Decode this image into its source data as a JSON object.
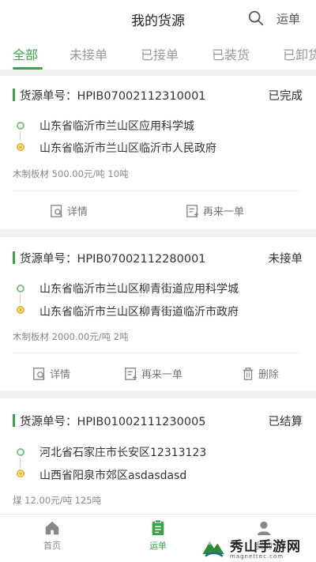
{
  "header": {
    "title": "我的货源",
    "waybill_label": "运单"
  },
  "tabs": [
    {
      "label": "全部",
      "active": true
    },
    {
      "label": "未接单",
      "active": false
    },
    {
      "label": "已接单",
      "active": false
    },
    {
      "label": "已装货",
      "active": false
    },
    {
      "label": "已卸货",
      "active": false
    }
  ],
  "orders": [
    {
      "order_label": "货源单号：HPIB07002112310001",
      "status": "已完成",
      "from": "山东省临沂市兰山区应用科学城",
      "to": "山东省临沂市兰山区临沂市人民政府",
      "meta": "木制板材  500.00元/吨  10吨",
      "actions": [
        "详情",
        "再来一单"
      ]
    },
    {
      "order_label": "货源单号：HPIB07002112280001",
      "status": "未接单",
      "from": "山东省临沂市兰山区柳青街道应用科学城",
      "to": "山东省临沂市兰山区柳青街道临沂市政府",
      "meta": "木制板材  2000.00元/吨  2吨",
      "actions": [
        "详情",
        "再来一单",
        "删除"
      ]
    },
    {
      "order_label": "货源单号：HPIB01002111230005",
      "status": "已结算",
      "from": "河北省石家庄市长安区12313123",
      "to": "山西省阳泉市郊区asdasdasd",
      "meta": "煤  12.00元/吨  125吨",
      "actions": []
    }
  ],
  "bottom_nav": [
    {
      "label": "首页",
      "icon": "home-icon",
      "active": false
    },
    {
      "label": "运单",
      "icon": "waybill-icon",
      "active": true
    },
    {
      "label": "我的",
      "icon": "user-icon",
      "active": false
    }
  ],
  "watermark": {
    "main": "秀山手游网",
    "sub": "magnettec.com"
  },
  "colors": {
    "accent": "#39a447",
    "origin": "#7bc47f",
    "destination": "#f0b323"
  }
}
